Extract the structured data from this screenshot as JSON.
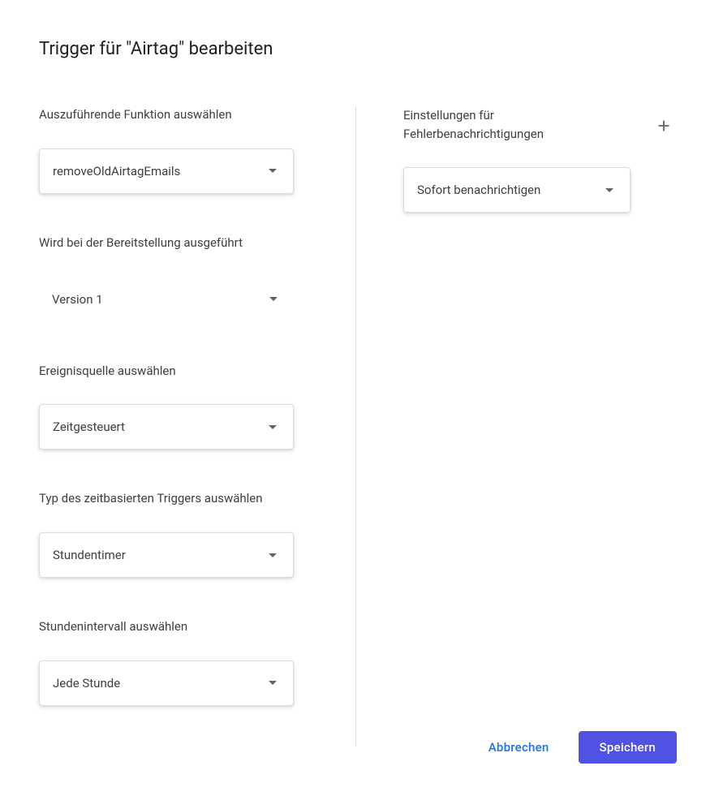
{
  "title": "Trigger für \"Airtag\" bearbeiten",
  "left": {
    "function": {
      "label": "Auszuführende Funktion auswählen",
      "value": "removeOldAirtagEmails"
    },
    "deployment": {
      "label": "Wird bei der Bereitstellung ausgeführt",
      "value": "Version 1"
    },
    "eventSource": {
      "label": "Ereignisquelle auswählen",
      "value": "Zeitgesteuert"
    },
    "triggerType": {
      "label": "Typ des zeitbasierten Triggers auswählen",
      "value": "Stundentimer"
    },
    "interval": {
      "label": "Stundenintervall auswählen",
      "value": "Jede Stunde"
    }
  },
  "right": {
    "errorNotification": {
      "label": "Einstellungen für Fehlerbenachrichtigungen",
      "value": "Sofort benachrichtigen"
    }
  },
  "footer": {
    "cancel": "Abbrechen",
    "save": "Speichern"
  }
}
